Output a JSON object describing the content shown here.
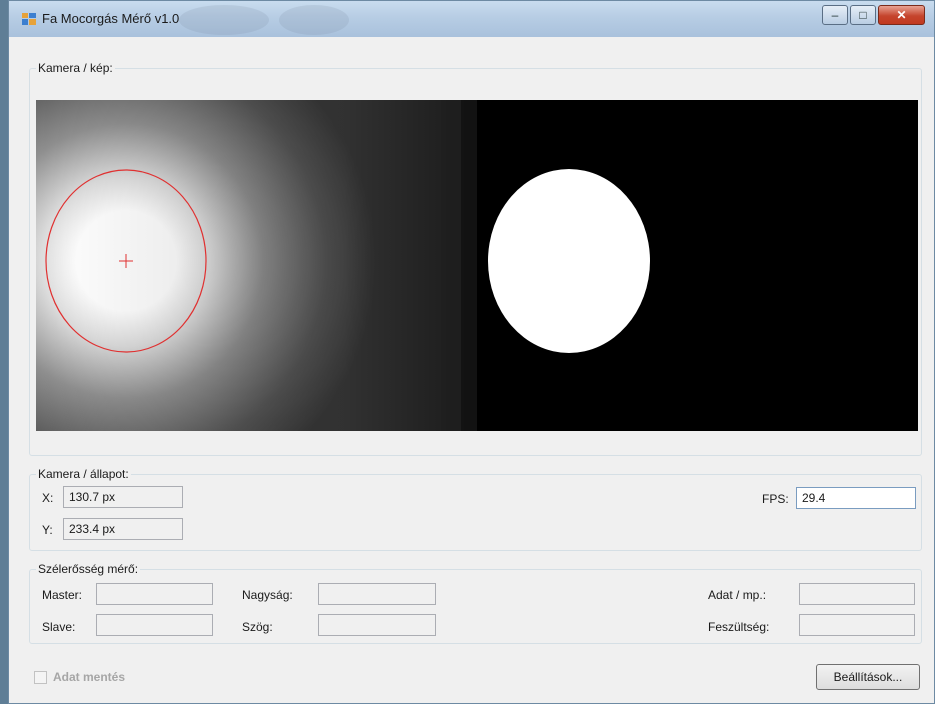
{
  "window": {
    "title": "Fa Mocorgás Mérő v1.0",
    "controls": {
      "minimize": "–",
      "maximize": "□",
      "close": "✕"
    }
  },
  "camera_image_group": {
    "label": "Kamera / kép:"
  },
  "camera_status_group": {
    "label": "Kamera / állapot:",
    "x_label": "X:",
    "x_value": "130.7 px",
    "y_label": "Y:",
    "y_value": "233.4 px",
    "fps_label": "FPS:",
    "fps_value": "29.4"
  },
  "meter_group": {
    "label": "Szélerősség mérő:",
    "master_label": "Master:",
    "slave_label": "Slave:",
    "magnitude_label": "Nagyság:",
    "angle_label": "Szög:",
    "data_rate_label": "Adat / mp.:",
    "voltage_label": "Feszültség:",
    "master_value": "",
    "slave_value": "",
    "magnitude_value": "",
    "angle_value": "",
    "data_rate_value": "",
    "voltage_value": ""
  },
  "footer": {
    "save_data_label": "Adat mentés",
    "save_data_checked": false,
    "settings_button": "Beállítások..."
  },
  "colors": {
    "title_bar": "#b9cfe6",
    "close_button": "#c5452d",
    "tracking_marker": "#e03030"
  }
}
